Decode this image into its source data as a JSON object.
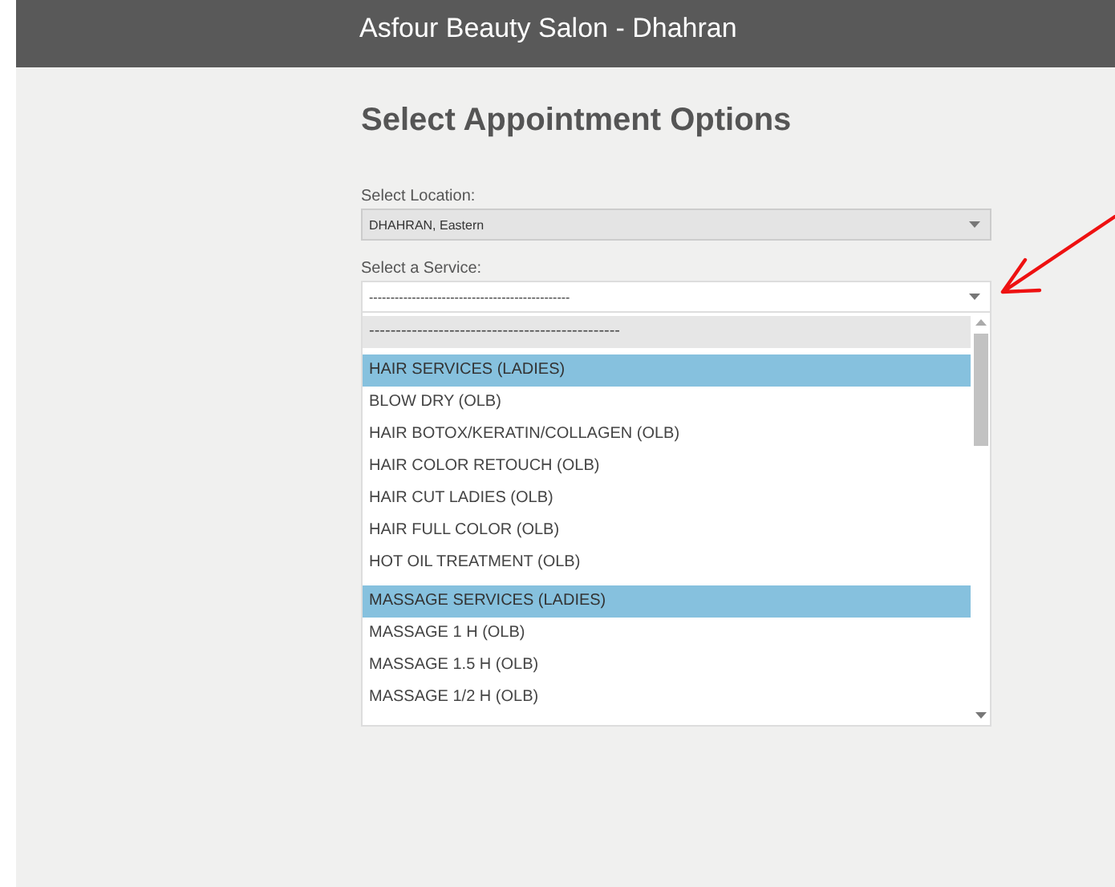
{
  "header": {
    "title": "Asfour Beauty Salon - Dhahran"
  },
  "heading": "Select Appointment Options",
  "fields": [
    {
      "label": "Select Location:",
      "value": "DHAHRAN, Eastern",
      "open": false
    },
    {
      "label": "Select a Service:",
      "value": "-----------------------------------------------",
      "open": true
    }
  ],
  "dropdown": {
    "options": [
      {
        "kind": "placeholder",
        "text": "-----------------------------------------------",
        "selected": true
      },
      {
        "kind": "group",
        "text": "HAIR SERVICES (LADIES)"
      },
      {
        "kind": "option",
        "text": "BLOW DRY (OLB)",
        "selected": false
      },
      {
        "kind": "option",
        "text": "HAIR BOTOX/KERATIN/COLLAGEN (OLB)",
        "selected": false
      },
      {
        "kind": "option",
        "text": "HAIR COLOR RETOUCH (OLB)",
        "selected": false
      },
      {
        "kind": "option",
        "text": "HAIR CUT LADIES (OLB)",
        "selected": false
      },
      {
        "kind": "option",
        "text": "HAIR FULL COLOR (OLB)",
        "selected": false
      },
      {
        "kind": "option",
        "text": "HOT OIL TREATMENT (OLB)",
        "selected": false
      },
      {
        "kind": "group",
        "text": "MASSAGE SERVICES (LADIES)"
      },
      {
        "kind": "option",
        "text": "MASSAGE 1 H (OLB)",
        "selected": false
      },
      {
        "kind": "option",
        "text": "MASSAGE 1.5 H (OLB)",
        "selected": false
      },
      {
        "kind": "option",
        "text": "MASSAGE 1/2 H (OLB)",
        "selected": false
      }
    ]
  }
}
